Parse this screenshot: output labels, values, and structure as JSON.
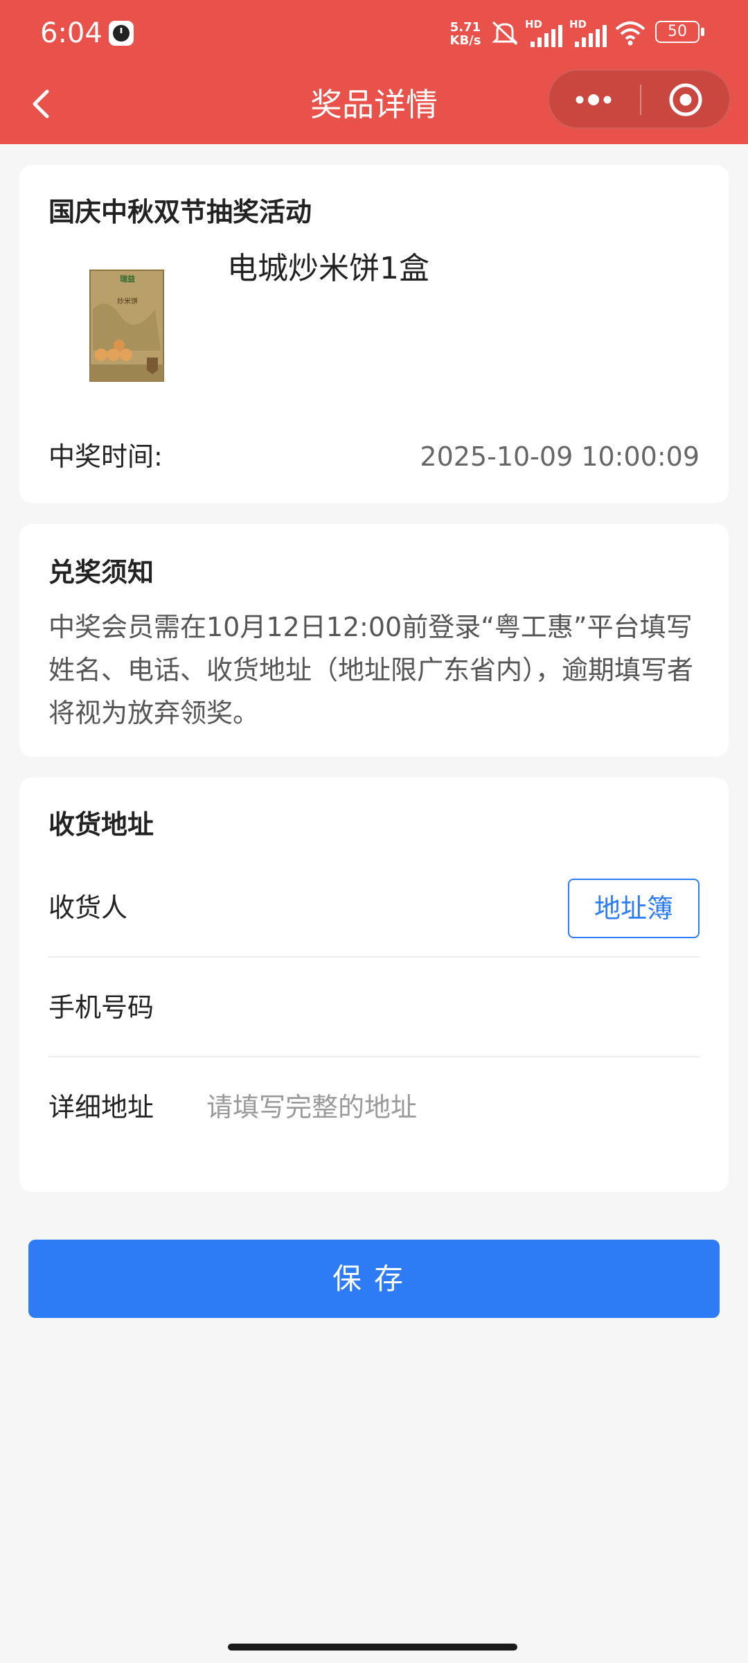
{
  "status_bar": {
    "time": "6:04",
    "network_speed_value": "5.71",
    "network_speed_unit": "KB/s",
    "sim1_label": "HD",
    "sim2_label": "HD",
    "battery": "50"
  },
  "nav": {
    "title": "奖品详情"
  },
  "prize_card": {
    "activity_title": "国庆中秋双节抽奖活动",
    "prize_name": "电城炒米饼1盒",
    "win_time_label": "中奖时间:",
    "win_time_value": "2025-10-09 10:00:09",
    "image_text_brand": "瑞益",
    "image_text_product": "炒米饼"
  },
  "notice_card": {
    "title": "兑奖须知",
    "text": "中奖会员需在10月12日12:00前登录“粤工惠”平台填写姓名、电话、收货地址（地址限广东省内），逾期填写者将视为放弃领奖。"
  },
  "address_card": {
    "title": "收货地址",
    "fields": [
      {
        "label": "收货人",
        "value": "",
        "placeholder": ""
      },
      {
        "label": "手机号码",
        "value": "",
        "placeholder": ""
      },
      {
        "label": "详细地址",
        "value": "",
        "placeholder": "请填写完整的地址"
      }
    ],
    "address_book_label": "地址簿"
  },
  "save_label": "保存",
  "colors": {
    "header_red": "#e8524a",
    "primary_blue": "#2d7cf6",
    "background": "#f6f6f6"
  }
}
